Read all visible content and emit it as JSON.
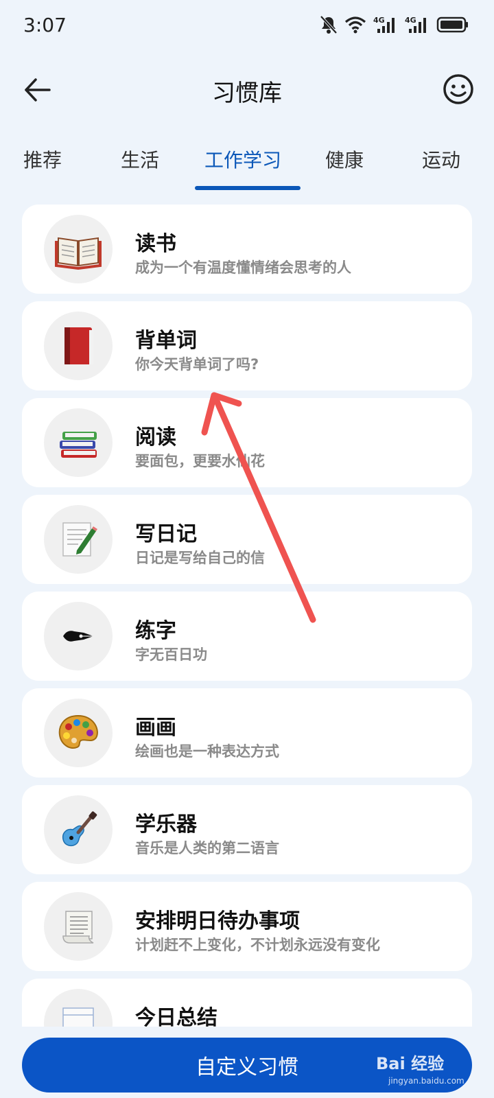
{
  "status_bar": {
    "time": "3:07",
    "icons": [
      "bell-off-icon",
      "wifi-icon",
      "signal-4g-icon",
      "signal-4g-icon",
      "battery-icon"
    ],
    "net1": "4G",
    "net2": "4G"
  },
  "header": {
    "title": "习惯库",
    "back_icon": "arrow-left-icon",
    "menu_icon": "smiley-face-icon"
  },
  "tabs": [
    {
      "label": "推荐",
      "active": false
    },
    {
      "label": "生活",
      "active": false
    },
    {
      "label": "工作学习",
      "active": true
    },
    {
      "label": "健康",
      "active": false
    },
    {
      "label": "运动",
      "active": false
    }
  ],
  "habits": [
    {
      "title": "读书",
      "subtitle": "成为一个有温度懂情绪会思考的人",
      "icon": "open-book-icon"
    },
    {
      "title": "背单词",
      "subtitle": "你今天背单词了吗?",
      "icon": "red-book-icon"
    },
    {
      "title": "阅读",
      "subtitle": "要面包，更要水仙花",
      "icon": "book-stack-icon"
    },
    {
      "title": "写日记",
      "subtitle": "日记是写给自己的信",
      "icon": "memo-pencil-icon"
    },
    {
      "title": "练字",
      "subtitle": "字无百日功",
      "icon": "fountain-pen-nib-icon"
    },
    {
      "title": "画画",
      "subtitle": "绘画也是一种表达方式",
      "icon": "artist-palette-icon"
    },
    {
      "title": "学乐器",
      "subtitle": "音乐是人类的第二语言",
      "icon": "guitar-icon"
    },
    {
      "title": "安排明日待办事项",
      "subtitle": "计划赶不上变化，不计划永远没有变化",
      "icon": "scroll-list-icon"
    },
    {
      "title": "今日总结",
      "subtitle": "",
      "icon": "calendar-icon"
    }
  ],
  "footer": {
    "button_label": "自定义习惯"
  },
  "watermark": {
    "brand": "Bai  经验",
    "url": "jingyan.baidu.com"
  },
  "colors": {
    "accent": "#0b57b8",
    "button": "#0b55c6",
    "background": "#eef4fb",
    "annotation_arrow": "#ef5350"
  }
}
